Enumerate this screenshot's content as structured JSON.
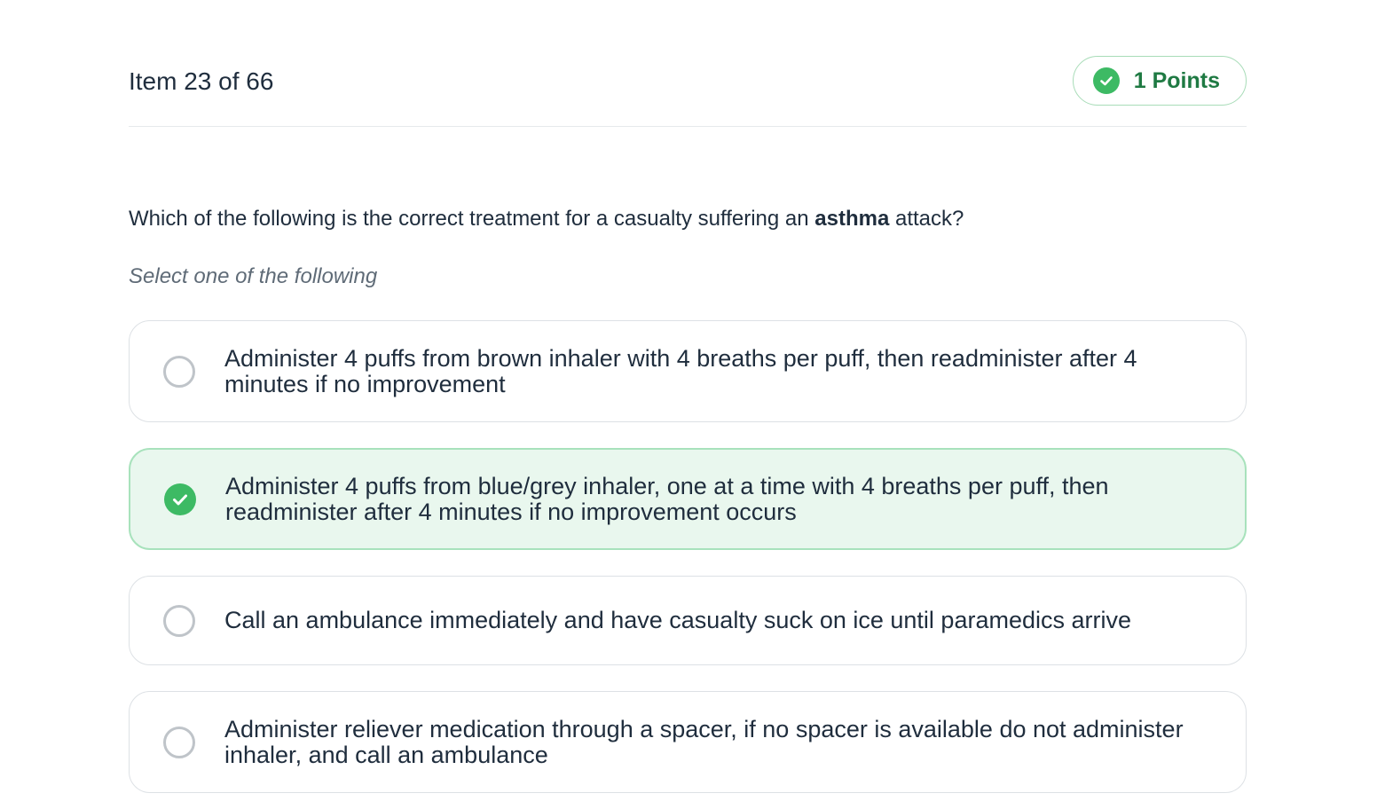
{
  "header": {
    "item_counter": "Item 23 of 66",
    "points_label": "1 Points",
    "points_icon": "check-circle-icon",
    "accent_color": "#3dba64"
  },
  "question": {
    "text_before": "Which of the following is the correct treatment for a casualty suffering an ",
    "text_bold": "asthma",
    "text_after": " attack?",
    "instruction": "Select one of the following"
  },
  "options": [
    {
      "label": "Administer 4 puffs from brown inhaler with 4 breaths per puff, then readminister after 4 minutes if no improvement",
      "selected": false
    },
    {
      "label": "Administer 4 puffs from blue/grey inhaler, one at a time with 4 breaths per puff, then readminister after 4 minutes if no improvement occurs",
      "selected": true,
      "icon": "check-circle-icon"
    },
    {
      "label": "Call an ambulance immediately and have casualty suck on ice until paramedics arrive",
      "selected": false
    },
    {
      "label": "Administer reliever medication through a spacer, if no spacer is available do not administer inhaler, and call an ambulance",
      "selected": false
    }
  ]
}
